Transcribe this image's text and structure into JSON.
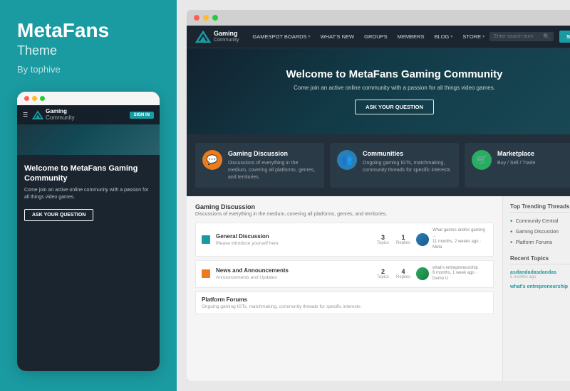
{
  "leftPanel": {
    "title": "MetaFans",
    "subtitle": "Theme",
    "by": "By tophive",
    "mobilePreview": {
      "dots": [
        {
          "color": "#ff5f57"
        },
        {
          "color": "#febc2e"
        },
        {
          "color": "#28c840"
        }
      ],
      "nav": {
        "logoText": "Gaming",
        "logoSub": "Community",
        "signinLabel": "SIGN IN"
      },
      "hero": {
        "title": "Welcome to MetaFans Gaming Community",
        "subtitle": "Come join an active online community with a passion for all things video games.",
        "buttonLabel": "ASK YOUR QUESTION"
      }
    }
  },
  "rightPanel": {
    "browserDots": [
      {
        "color": "#aaa"
      },
      {
        "color": "#aaa"
      },
      {
        "color": "#aaa"
      }
    ],
    "nav": {
      "logoText": "Gaming",
      "logoSub": "Community",
      "links": [
        {
          "label": "GAMESPOT BOARDS",
          "hasChevron": true
        },
        {
          "label": "WHAT'S NEW",
          "hasChevron": false
        },
        {
          "label": "GROUPS",
          "hasChevron": false
        },
        {
          "label": "MEMBERS",
          "hasChevron": false
        },
        {
          "label": "BLOG",
          "hasChevron": true
        },
        {
          "label": "STORE",
          "hasChevron": true
        }
      ],
      "searchPlaceholder": "Enter search term",
      "signinLabel": "SIGN IN"
    },
    "hero": {
      "title": "Welcome to MetaFans Gaming Community",
      "subtitle": "Come join an active online community with a passion for all things video games.",
      "buttonLabel": "ASK YOUR QUESTION"
    },
    "featureCards": [
      {
        "icon": "💬",
        "iconStyle": "orange",
        "title": "Gaming Discussion",
        "desc": "Discussions of everything in the medium, covering all platforms, genres, and territories."
      },
      {
        "icon": "👥",
        "iconStyle": "blue",
        "title": "Communities",
        "desc": "Ongoing gaming IGTs, matchmaking, community threads for specific interests"
      },
      {
        "icon": "🛒",
        "iconStyle": "green",
        "title": "Marketplace",
        "desc": "Buy / Sell / Trade"
      }
    ],
    "mainSection": {
      "title": "Gaming Discussion",
      "subtitle": "Discussions of everything in the medium, covering all platforms, genres, and territories.",
      "forums": [
        {
          "name": "General Discussion",
          "desc": "Please introduce yourself here",
          "topics": "3",
          "replies": "1",
          "latestPost": "What games and/or gaming ...",
          "latestMeta": "11 months, 2 weeks ago · Meta"
        },
        {
          "name": "News and Announcements",
          "desc": "Announcements and Updates",
          "topics": "2",
          "replies": "4",
          "latestPost": "what's entrepreneurship",
          "latestMeta": "6 months, 1 week ago · Demo U"
        }
      ],
      "platformForum": {
        "name": "Platform Forums",
        "desc": "Ongoing gaming IGTs, matchmaking, community threads for specific interests"
      }
    },
    "sidebar": {
      "trendingTitle": "Top Trending Threads",
      "trendingItems": [
        "Community Central",
        "Gaming Discussion",
        "Platform Forums"
      ],
      "recentTitle": "Recent Topics",
      "recentItems": [
        {
          "name": "asdandadasdandas",
          "meta": "5 months ago"
        },
        {
          "name": "what's entrepreneurship",
          "meta": ""
        }
      ]
    }
  }
}
